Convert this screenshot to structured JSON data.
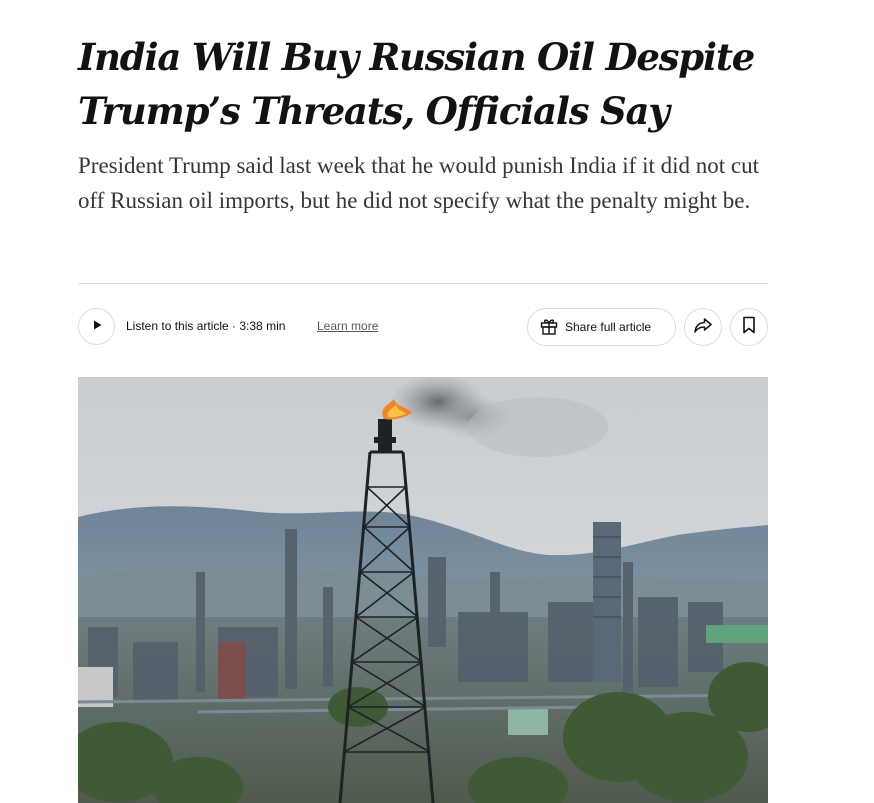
{
  "article": {
    "headline": "India Will Buy Russian Oil Despite Trump’s Threats, Officials Say",
    "summary": "President Trump said last week that he would punish India if it did not cut off Russian oil imports, but he did not specify what the penalty might be."
  },
  "toolbar": {
    "listen_label": "Listen to this article · 3:38 min",
    "learn_more_label": "Learn more",
    "share_full_label": "Share full article",
    "icons": {
      "play": "play-icon",
      "gift": "gift-icon",
      "share": "share-arrow-icon",
      "save": "bookmark-icon"
    }
  },
  "image": {
    "description_icon": "refinery-photo"
  }
}
